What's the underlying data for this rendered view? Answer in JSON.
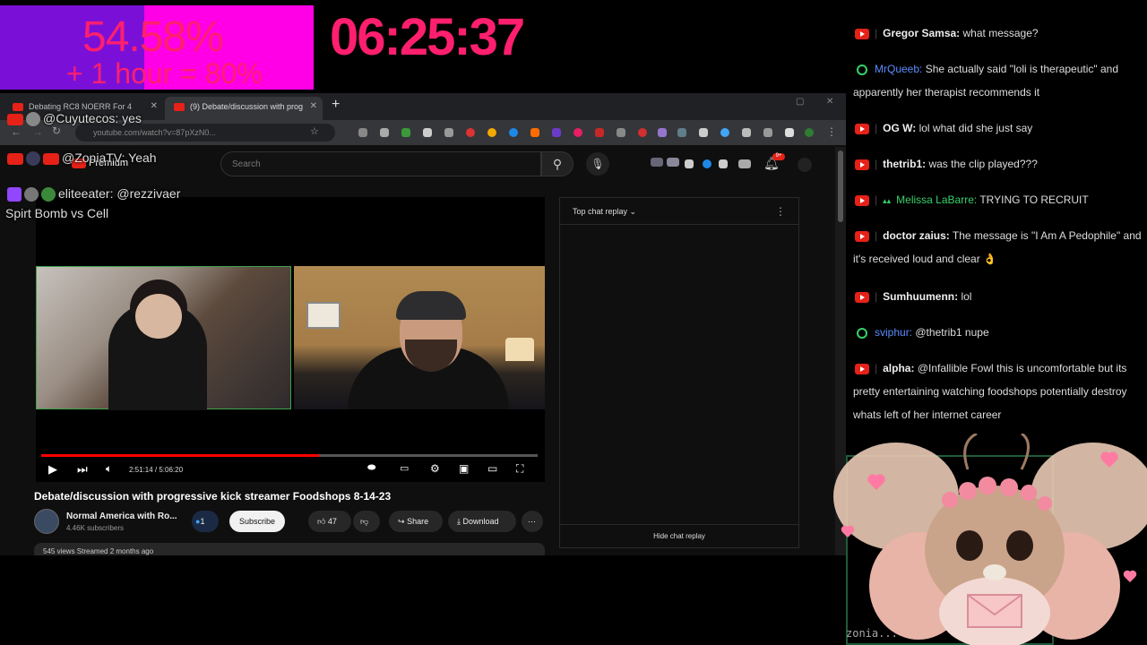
{
  "overlay": {
    "percent": "54.58%",
    "percent_fraction": 0.5458,
    "bonus": "+ 1 hour = 80%",
    "timer": "06:25:37"
  },
  "browser": {
    "tabs": [
      {
        "label": "Debating RC8 NOERR For 4"
      },
      {
        "label": "(9) Debate/discussion with prog"
      }
    ],
    "url": "youtube.com/watch?v=87pXzN0..."
  },
  "youtube": {
    "logo": "Premium",
    "search_placeholder": "Search",
    "notif_badge": "9+",
    "player": {
      "time": "2:51:14 / 5:06:20",
      "progress_fraction": 0.56
    },
    "video_title": "Debate/discussion with progressive kick streamer Foodshops 8-14-23",
    "channel_name": "Normal America with Ro...",
    "channel_subs": "4.46K subscribers",
    "subscribe": "Subscribe",
    "join_count": "1",
    "likes": "47",
    "share": "Share",
    "download": "Download",
    "desc": "545 views  Streamed 2 months ago",
    "live_chat_header": "Top chat replay",
    "hide_chat": "Hide chat replay"
  },
  "overlay_chat": [
    {
      "user": "@Cuyutecos:",
      "text": "yes"
    },
    {
      "user": "@ZoniaTV:",
      "text": "Yeah"
    },
    {
      "user": "eliteeater:",
      "text": "@rezzivaer"
    },
    {
      "user": "",
      "text": "Spirt Bomb vs Cell"
    }
  ],
  "chat": [
    {
      "user": "Gregor Samsa:",
      "text": "what message?",
      "style": "bold"
    },
    {
      "user": "MrQueeb:",
      "text": "She actually said \"loli is therapeutic\" and apparently her therapist recommends it",
      "style": "blue"
    },
    {
      "user": "OG W:",
      "text": "lol what did she just say",
      "style": "bold"
    },
    {
      "user": "thetrib1:",
      "text": "was the clip played???",
      "style": "bold"
    },
    {
      "user": "Melissa LaBarre:",
      "text": "TRYING TO RECRUIT",
      "style": "green"
    },
    {
      "user": "doctor zaius:",
      "text": "The message is \"I Am A Pedophile\" and it's received loud and clear 👌",
      "style": "bold"
    },
    {
      "user": "Sumhuumenn:",
      "text": "lol",
      "style": "bold"
    },
    {
      "user": "sviphur:",
      "text": "@thetrib1 nupe",
      "style": "blue"
    },
    {
      "user": "alpha:",
      "text": "@Infallible Fowl this is uncomfortable but its pretty entertaining watching foodshops potentially destroy whats left of her internet career",
      "style": "bold"
    }
  ],
  "mascot_label": "zonia..."
}
